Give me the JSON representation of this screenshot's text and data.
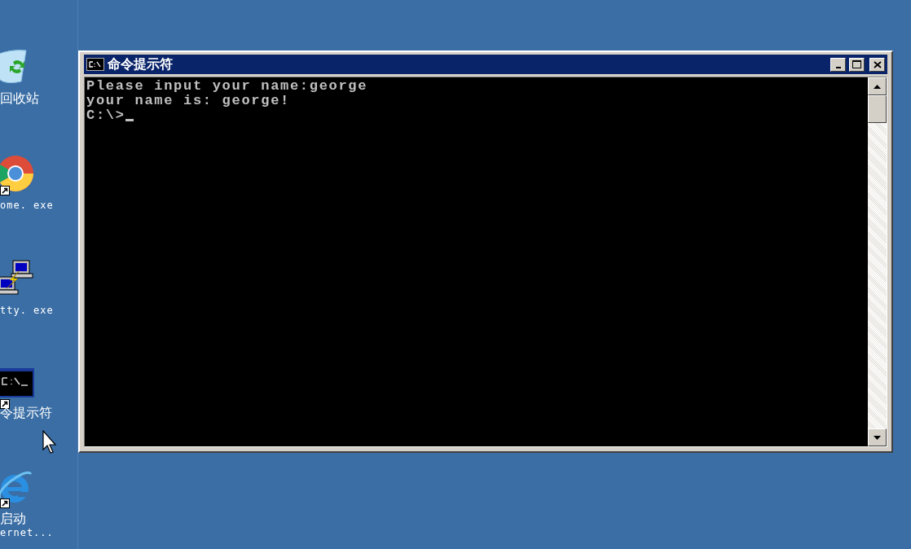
{
  "desktop_icons": [
    {
      "kind": "recycle",
      "lines": [
        "回收站"
      ]
    },
    {
      "kind": "chrome",
      "lines": [
        "ome. exe"
      ]
    },
    {
      "kind": "putty",
      "lines": [
        "tty. exe"
      ]
    },
    {
      "kind": "cmd",
      "lines": [
        "令提示符"
      ]
    },
    {
      "kind": "ie",
      "lines": [
        "启动",
        "ernet..."
      ]
    }
  ],
  "window": {
    "title": "命令提示符",
    "console_lines": [
      "Please input your name:george",
      "your name is: george!",
      "C:\\>"
    ]
  }
}
